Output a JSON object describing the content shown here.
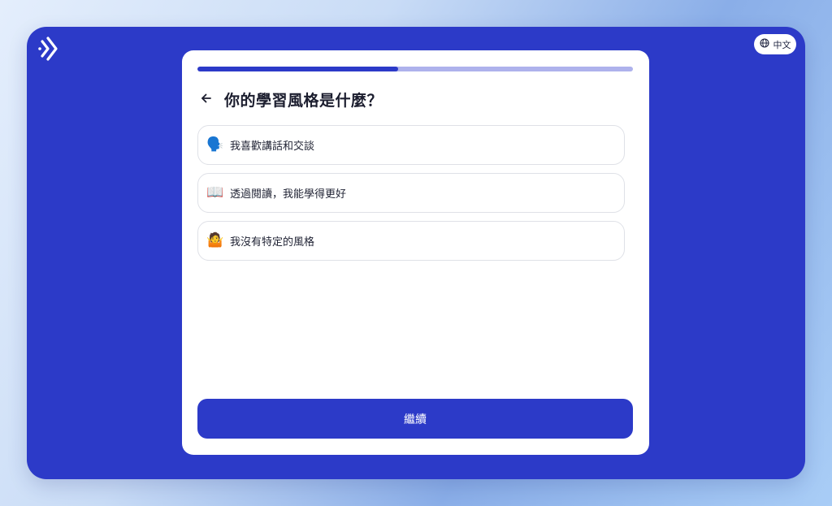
{
  "colors": {
    "brand": "#2c3ac8",
    "progress_track": "#aeb2ec",
    "card_bg": "#ffffff",
    "option_border": "#dfe1e7"
  },
  "header": {
    "logo_icon": "chevron-double-right-icon",
    "language": {
      "icon": "globe-icon",
      "label": "中文"
    }
  },
  "progress": {
    "fraction": 0.46
  },
  "question": {
    "back_icon": "arrow-left-icon",
    "title": "你的學習風格是什麼？"
  },
  "options": [
    {
      "emoji": "🗣️",
      "label": "我喜歡講話和交談"
    },
    {
      "emoji": "📖",
      "label": "透過閱讀，我能學得更好"
    },
    {
      "emoji": "🤷",
      "label": "我沒有特定的風格"
    }
  ],
  "continue_label": "繼續"
}
